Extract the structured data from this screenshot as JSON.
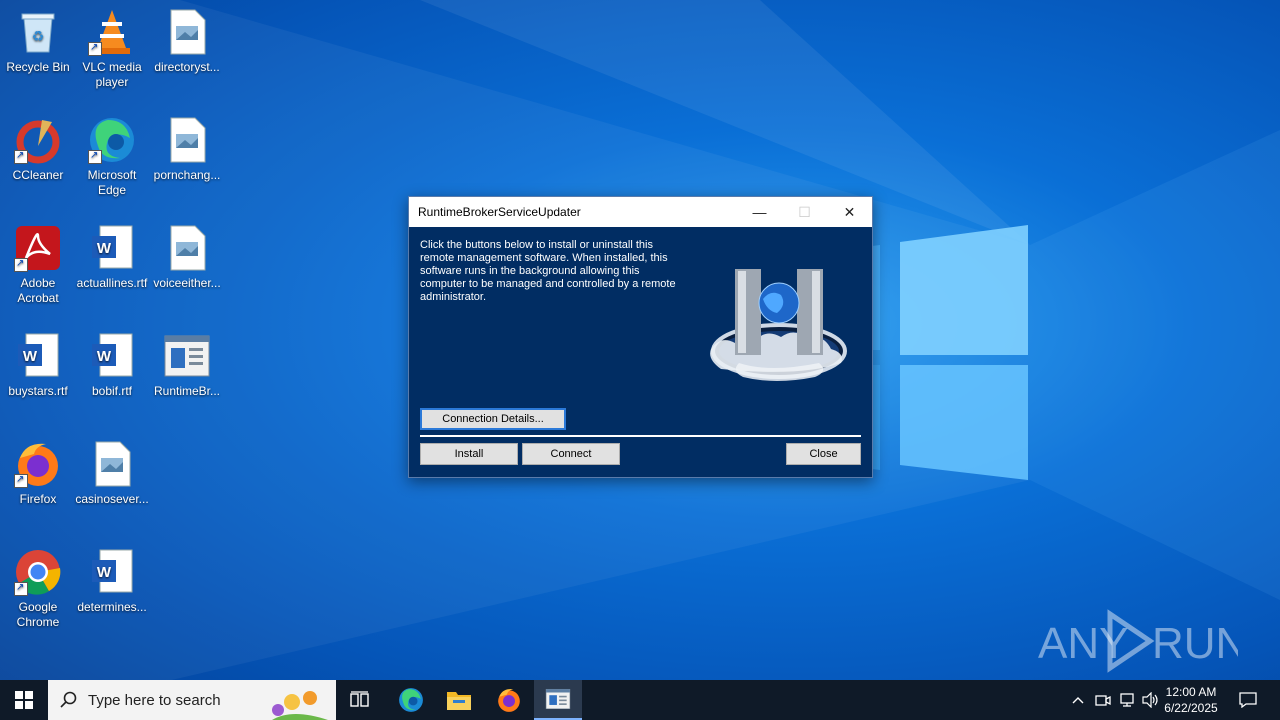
{
  "desktop": {
    "icons": [
      {
        "label": "Recycle Bin",
        "icon": "recycle-bin-icon"
      },
      {
        "label": "VLC media player",
        "icon": "vlc-icon"
      },
      {
        "label": "directoryst...",
        "icon": "image-file-icon"
      },
      {
        "label": "CCleaner",
        "icon": "ccleaner-icon"
      },
      {
        "label": "Microsoft Edge",
        "icon": "edge-icon"
      },
      {
        "label": "pornchang...",
        "icon": "image-file-icon"
      },
      {
        "label": "Adobe Acrobat",
        "icon": "acrobat-icon"
      },
      {
        "label": "actuallines.rtf",
        "icon": "word-doc-icon"
      },
      {
        "label": "voiceeither...",
        "icon": "image-file-icon"
      },
      {
        "label": "buystars.rtf",
        "icon": "word-doc-icon"
      },
      {
        "label": "bobif.rtf",
        "icon": "word-doc-icon"
      },
      {
        "label": "RuntimeBr...",
        "icon": "app-window-icon"
      },
      {
        "label": "Firefox",
        "icon": "firefox-icon"
      },
      {
        "label": "casinosever...",
        "icon": "image-file-icon"
      },
      {
        "label": "Google Chrome",
        "icon": "chrome-icon"
      },
      {
        "label": "determines...",
        "icon": "word-doc-icon"
      }
    ]
  },
  "dialog": {
    "title": "RuntimeBrokerServiceUpdater",
    "description": "Click the buttons below to install or uninstall this remote management software. When installed, this software runs in the background allowing this computer to be managed and controlled by a remote administrator.",
    "connection_details_label": "Connection Details...",
    "install_label": "Install",
    "connect_label": "Connect",
    "close_label": "Close",
    "minimize_glyph": "—",
    "maximize_glyph": "☐",
    "close_glyph": "✕",
    "background_color": "#012d63"
  },
  "taskbar": {
    "search_placeholder": "Type here to search",
    "time": "12:00 AM",
    "date": "6/22/2025",
    "apps": [
      "task-view-icon",
      "edge-icon",
      "file-explorer-icon",
      "firefox-icon",
      "runtimebroker-app-icon"
    ]
  },
  "watermark": {
    "text_left": "ANY",
    "text_right": "RUN"
  }
}
